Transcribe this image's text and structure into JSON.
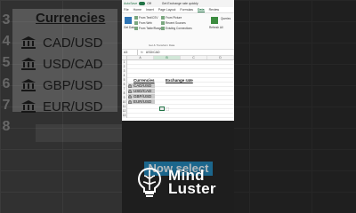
{
  "background": {
    "heading": "Currencies",
    "row_numbers": [
      "3",
      "4",
      "5",
      "6",
      "7",
      "8"
    ],
    "currencies": [
      "CAD/USD",
      "USD/CAD",
      "GBP/USD",
      "EUR/USD"
    ]
  },
  "excel": {
    "titlebar": {
      "autosave_label": "AutoSave",
      "toggle_label": "Off",
      "doc_title": "Get Exchange rate quickly"
    },
    "tabs": [
      "File",
      "Home",
      "Insert",
      "Page Layout",
      "Formulas",
      "Data",
      "Review"
    ],
    "active_tab": "Data",
    "ribbon": {
      "get_data_label": "Get Data",
      "buttons": [
        "From Text/CSV",
        "From Web",
        "From Table/Range",
        "From Picture",
        "Recent Sources",
        "Existing Connections",
        "Refresh All",
        "Queries"
      ],
      "group_label": "Get & Transform Data"
    },
    "namebox": "A3",
    "formula": "USD/CAD",
    "columns": [
      "A",
      "B",
      "C",
      "D"
    ],
    "selected_column": "B",
    "row_numbers": [
      "1",
      "2",
      "3",
      "4",
      "5",
      "6",
      "7",
      "8",
      "9",
      "10",
      "11",
      "12",
      "13"
    ],
    "sheet_heading": "Currencies",
    "sheet_heading2": "Exchange rate",
    "currencies": [
      "CAD/USD",
      "USD/CAD",
      "GBP/USD",
      "EUR/USD"
    ]
  },
  "caption": "Now select",
  "logo": {
    "line1": "Mind",
    "line2": "Luster"
  },
  "colors": {
    "excel_green": "#217346",
    "caption_bg": "#1b7fb1"
  }
}
